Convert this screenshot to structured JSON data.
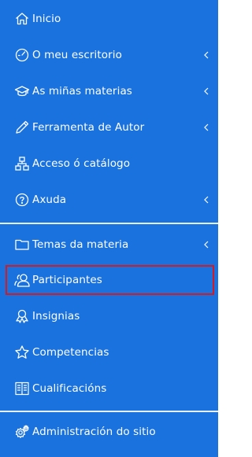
{
  "colors": {
    "sidebar_bg": "#1a72de",
    "text": "#ffffff",
    "highlight_border": "#d01c24",
    "divider": "#e8f0fb"
  },
  "menu": {
    "items": [
      {
        "label": "Inicio",
        "icon": "home-icon",
        "has_submenu": false
      },
      {
        "label": "O meu escritorio",
        "icon": "dashboard-gauge-icon",
        "has_submenu": true
      },
      {
        "label": "As miñas materias",
        "icon": "graduation-cap-icon",
        "has_submenu": true
      },
      {
        "label": "Ferramenta de Autor",
        "icon": "pencil-icon",
        "has_submenu": true
      },
      {
        "label": "Acceso ó catálogo",
        "icon": "sitemap-icon",
        "has_submenu": false
      },
      {
        "label": "Axuda",
        "icon": "help-circle-icon",
        "has_submenu": true
      },
      {
        "label": "Temas da materia",
        "icon": "folder-icon",
        "has_submenu": true
      },
      {
        "label": "Participantes",
        "icon": "users-icon",
        "has_submenu": false,
        "highlighted": true
      },
      {
        "label": "Insignias",
        "icon": "badge-icon",
        "has_submenu": false
      },
      {
        "label": "Competencias",
        "icon": "star-icon",
        "has_submenu": false
      },
      {
        "label": "Cualificacións",
        "icon": "gradebook-icon",
        "has_submenu": false
      },
      {
        "label": "Administración do sitio",
        "icon": "gears-icon",
        "has_submenu": false
      }
    ]
  }
}
